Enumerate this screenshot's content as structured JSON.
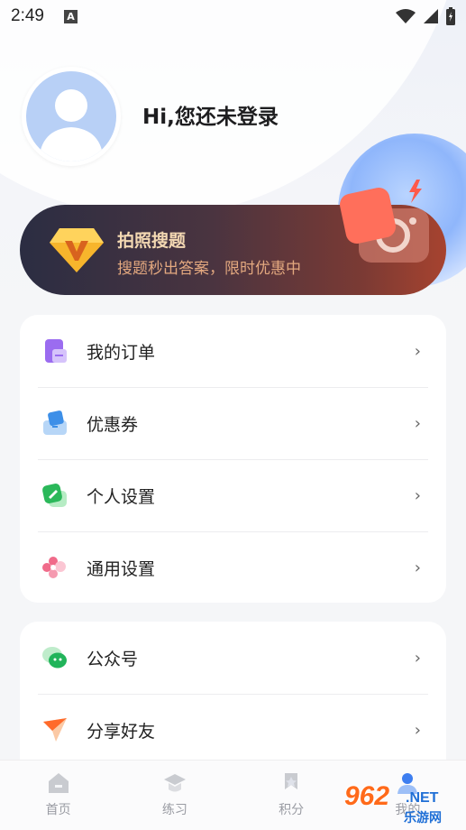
{
  "status_bar": {
    "time": "2:49",
    "notification_letter": "A",
    "icons": [
      "wifi-icon",
      "signal-icon",
      "battery-icon"
    ]
  },
  "profile": {
    "greeting": "Hi,您还未登录",
    "avatar": "default-avatar-icon"
  },
  "vip_banner": {
    "title": "拍照搜题",
    "subtitle": "搜题秒出答案，限时优惠中",
    "badge_letter": "V"
  },
  "menu_group_1": [
    {
      "label": "我的订单",
      "icon": "order-icon"
    },
    {
      "label": "优惠券",
      "icon": "coupon-icon"
    },
    {
      "label": "个人设置",
      "icon": "personal-settings-icon"
    },
    {
      "label": "通用设置",
      "icon": "general-settings-icon"
    }
  ],
  "menu_group_2": [
    {
      "label": "公众号",
      "icon": "wechat-icon"
    },
    {
      "label": "分享好友",
      "icon": "share-icon"
    }
  ],
  "chevron": "›",
  "tabbar": [
    {
      "label": "首页",
      "icon": "home-icon"
    },
    {
      "label": "练习",
      "icon": "practice-icon"
    },
    {
      "label": "积分",
      "icon": "points-icon"
    },
    {
      "label": "我的",
      "icon": "profile-icon",
      "active": true
    }
  ],
  "watermark": {
    "number": "962",
    "domain": ".NET",
    "name": "乐游网"
  },
  "colors": {
    "banner_title": "#f3d8b2",
    "banner_subtitle": "#e3a87f",
    "tab_inactive": "#9a9ca3",
    "watermark_orange": "#ff6a1a",
    "watermark_blue": "#1f6fd6"
  }
}
